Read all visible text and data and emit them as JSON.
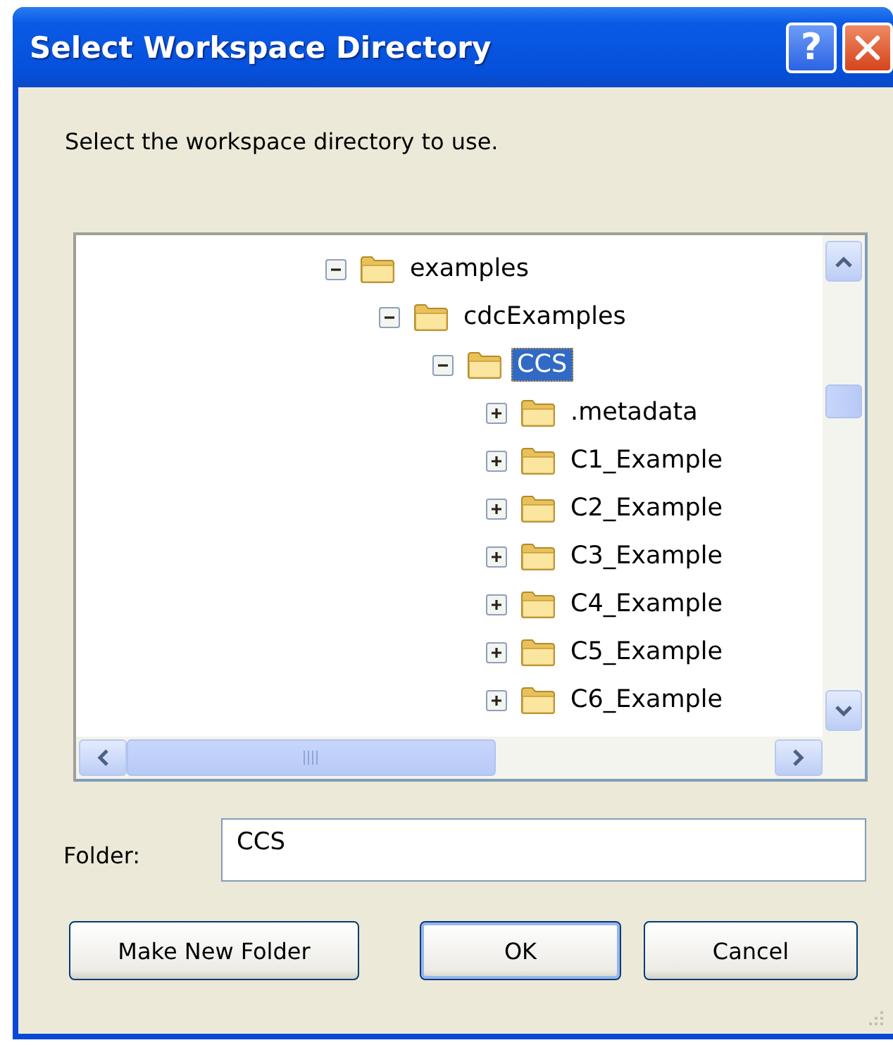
{
  "window": {
    "title": "Select Workspace Directory",
    "help_button": "?"
  },
  "instruction": "Select the workspace directory to use.",
  "tree": [
    {
      "label": "examples",
      "expanded": true,
      "selected": false,
      "children": [
        {
          "label": "cdcExamples",
          "expanded": true,
          "selected": false,
          "children": [
            {
              "label": "CCS",
              "expanded": true,
              "selected": true,
              "children": [
                {
                  "label": ".metadata",
                  "expanded": false,
                  "selected": false
                },
                {
                  "label": "C1_Example",
                  "expanded": false,
                  "selected": false
                },
                {
                  "label": "C2_Example",
                  "expanded": false,
                  "selected": false
                },
                {
                  "label": "C3_Example",
                  "expanded": false,
                  "selected": false
                },
                {
                  "label": "C4_Example",
                  "expanded": false,
                  "selected": false
                },
                {
                  "label": "C5_Example",
                  "expanded": false,
                  "selected": false
                },
                {
                  "label": "C6_Example",
                  "expanded": false,
                  "selected": false
                }
              ]
            }
          ]
        }
      ]
    }
  ],
  "folder": {
    "label": "Folder:",
    "value": "CCS"
  },
  "buttons": [
    {
      "label": "Make New Folder",
      "default": false
    },
    {
      "label": "OK",
      "default": true
    },
    {
      "label": "Cancel",
      "default": false
    }
  ]
}
